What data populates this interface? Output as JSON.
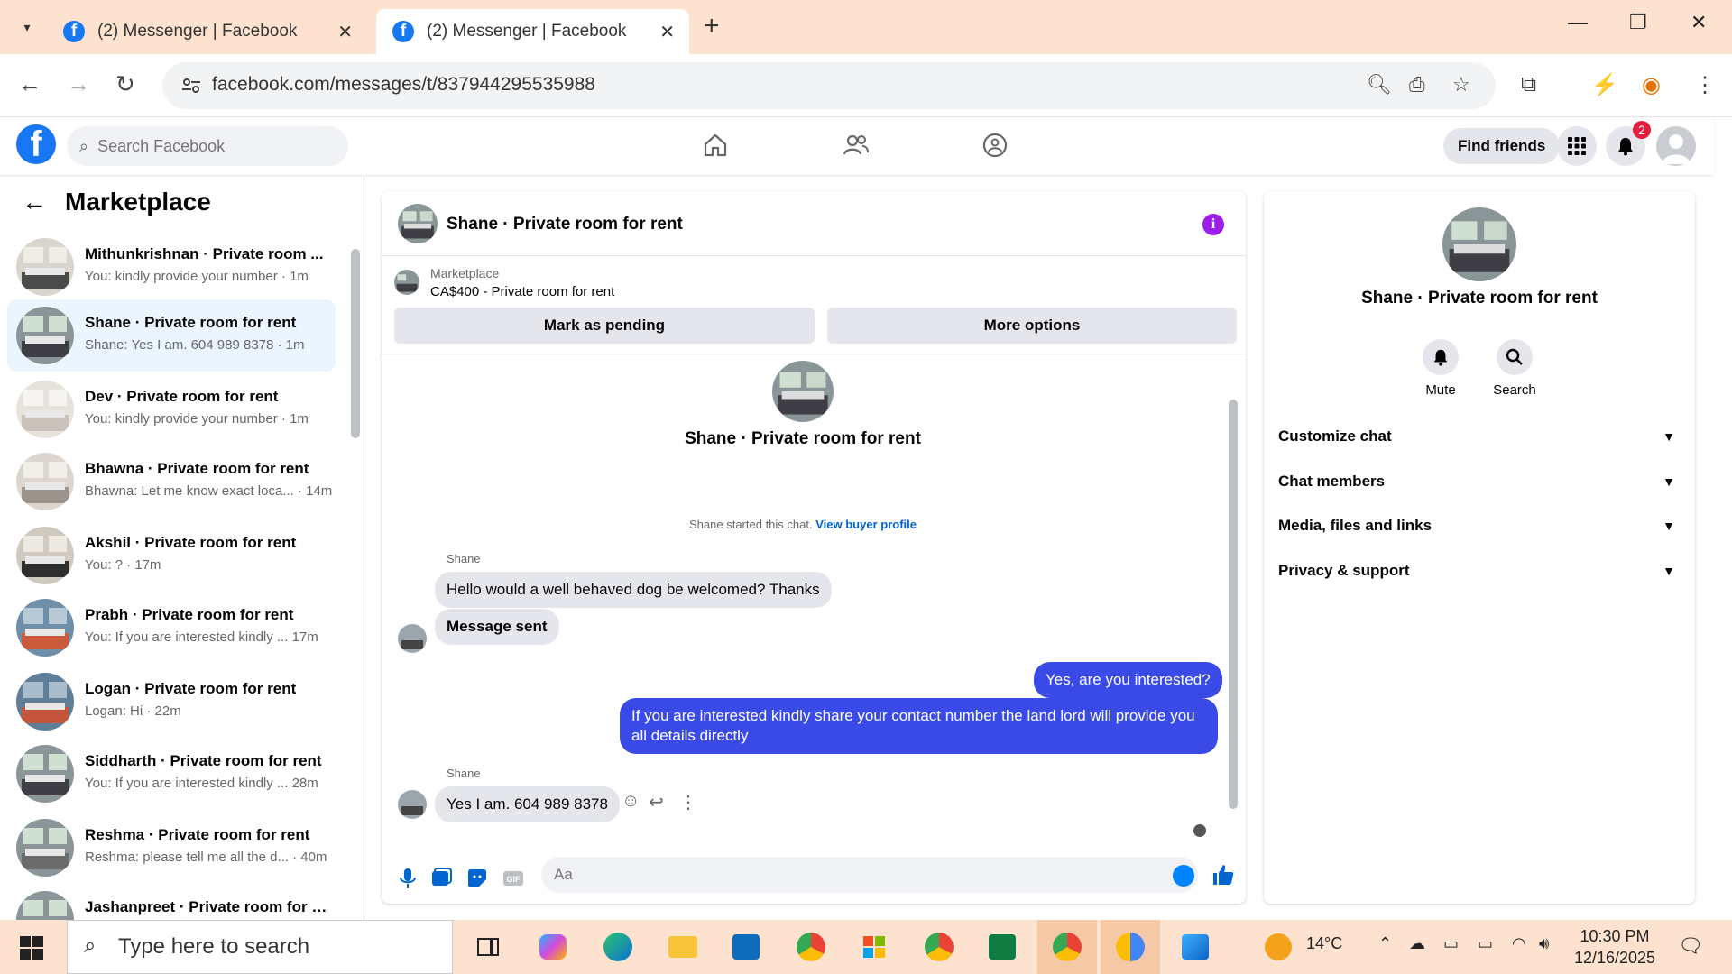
{
  "browser": {
    "tabs": [
      {
        "title": "(2) Messenger | Facebook"
      },
      {
        "title": "(2) Messenger | Facebook"
      }
    ],
    "url": "facebook.com/messages/t/837944295535988"
  },
  "fb_header": {
    "logo": "f",
    "search_placeholder": "Search Facebook",
    "find_friends": "Find friends",
    "notifications_count": "2"
  },
  "left_panel": {
    "title": "Marketplace",
    "conversations": [
      {
        "name": "Mithunkrishnan · Private room ...",
        "preview": "You: kindly provide your number · 1m"
      },
      {
        "name": "Shane · Private room for rent",
        "preview": "Shane: Yes I am. 604 989 8378 · 1m"
      },
      {
        "name": "Dev · Private room for rent",
        "preview": "You: kindly provide your number · 1m"
      },
      {
        "name": "Bhawna · Private room for rent",
        "preview": "Bhawna: Let me know exact loca... · 14m"
      },
      {
        "name": "Akshil · Private room for rent",
        "preview": "You: ? · 17m"
      },
      {
        "name": "Prabh · Private room for rent",
        "preview": "You: If you are interested kindly ...  17m"
      },
      {
        "name": "Logan · Private room for rent",
        "preview": "Logan: Hi · 22m"
      },
      {
        "name": "Siddharth · Private room for rent",
        "preview": "You: If you are interested kindly ...  28m"
      },
      {
        "name": "Reshma · Private room for rent",
        "preview": "Reshma: please tell me all the d... · 40m"
      },
      {
        "name": "Jashanpreet · Private room for r...",
        "preview": ""
      }
    ]
  },
  "chat": {
    "title": "Shane · Private room for rent",
    "marketplace_label": "Marketplace",
    "listing": "CA$400 - Private room for rent",
    "mark_pending": "Mark as pending",
    "more_options": "More options",
    "center_name": "Shane · Private room for rent",
    "started_text": "Shane started this chat.",
    "view_profile": "View buyer profile",
    "sender1": "Shane",
    "msg1": "Hello would a well behaved dog be welcomed? Thanks",
    "msg2": "Message sent",
    "msg3": "Yes, are you interested?",
    "msg4": "If you are interested kindly share your contact number the land lord will provide you all details directly",
    "sender2": "Shane",
    "msg5": "Yes I am. 604 989 8378",
    "composer_placeholder": "Aa"
  },
  "right_panel": {
    "name": "Shane · Private room for rent",
    "mute": "Mute",
    "search": "Search",
    "rows": [
      "Customize chat",
      "Chat members",
      "Media, files and links",
      "Privacy & support"
    ]
  },
  "taskbar": {
    "search_placeholder": "Type here to search",
    "weather": "14°C",
    "time": "10:30 PM",
    "date": "12/16/2025"
  },
  "colors": {
    "brand": "#1877f2",
    "outgoing_bubble": "#3a4ae7",
    "browser_chrome": "#fde3cf",
    "info_icon": "#9b1fe8"
  }
}
